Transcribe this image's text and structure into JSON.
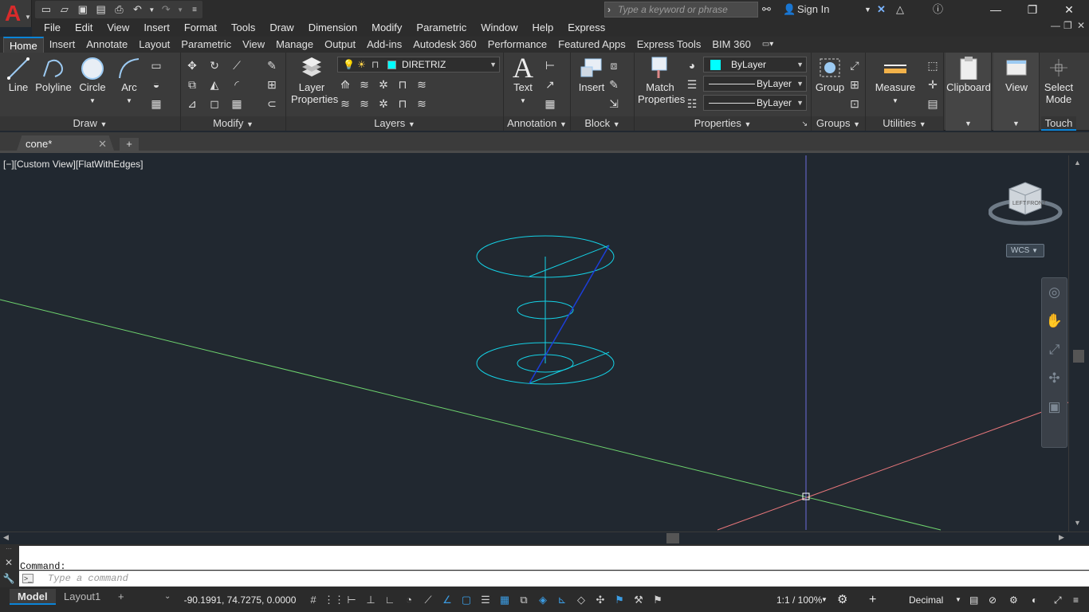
{
  "app": {
    "search_placeholder": "Type a keyword or phrase",
    "sign_in": "Sign In"
  },
  "menu": [
    "File",
    "Edit",
    "View",
    "Insert",
    "Format",
    "Tools",
    "Draw",
    "Dimension",
    "Modify",
    "Parametric",
    "Window",
    "Help",
    "Express"
  ],
  "ribbon_tabs": [
    "Home",
    "Insert",
    "Annotate",
    "Layout",
    "Parametric",
    "View",
    "Manage",
    "Output",
    "Add-ins",
    "Autodesk 360",
    "Performance",
    "Featured Apps",
    "Express Tools",
    "BIM 360"
  ],
  "active_tab": "Home",
  "ribbon": {
    "draw": {
      "title": "Draw",
      "line": "Line",
      "polyline": "Polyline",
      "circle": "Circle",
      "arc": "Arc"
    },
    "modify": {
      "title": "Modify"
    },
    "layers": {
      "title": "Layers",
      "layer_properties": "Layer Properties",
      "current_layer": "DIRETRIZ",
      "layer_color": "#00ffff"
    },
    "annotation": {
      "title": "Annotation",
      "text": "Text"
    },
    "block": {
      "title": "Block",
      "insert": "Insert"
    },
    "properties": {
      "title": "Properties",
      "match": "Match Properties",
      "color": "ByLayer",
      "linetype": "ByLayer",
      "lineweight": "ByLayer"
    },
    "groups": {
      "title": "Groups",
      "group": "Group"
    },
    "utilities": {
      "title": "Utilities",
      "measure": "Measure"
    },
    "clipboard": {
      "title": "Clipboard"
    },
    "view": {
      "title": "View"
    },
    "touch": {
      "title": "Touch",
      "select_mode": "Select Mode"
    }
  },
  "document": {
    "tab": "cone*"
  },
  "viewport": {
    "label": "[−][Custom View][FlatWithEdges]",
    "wcs": "WCS",
    "viewcube_left": "LEFT",
    "viewcube_front": "FRONT"
  },
  "command": {
    "history": "Command:",
    "placeholder": "Type a command"
  },
  "status": {
    "model": "Model",
    "layout1": "Layout1",
    "coords": "-90.1991, 74.7275, 0.0000",
    "scale": "1:1 / 100%",
    "units": "Decimal"
  }
}
